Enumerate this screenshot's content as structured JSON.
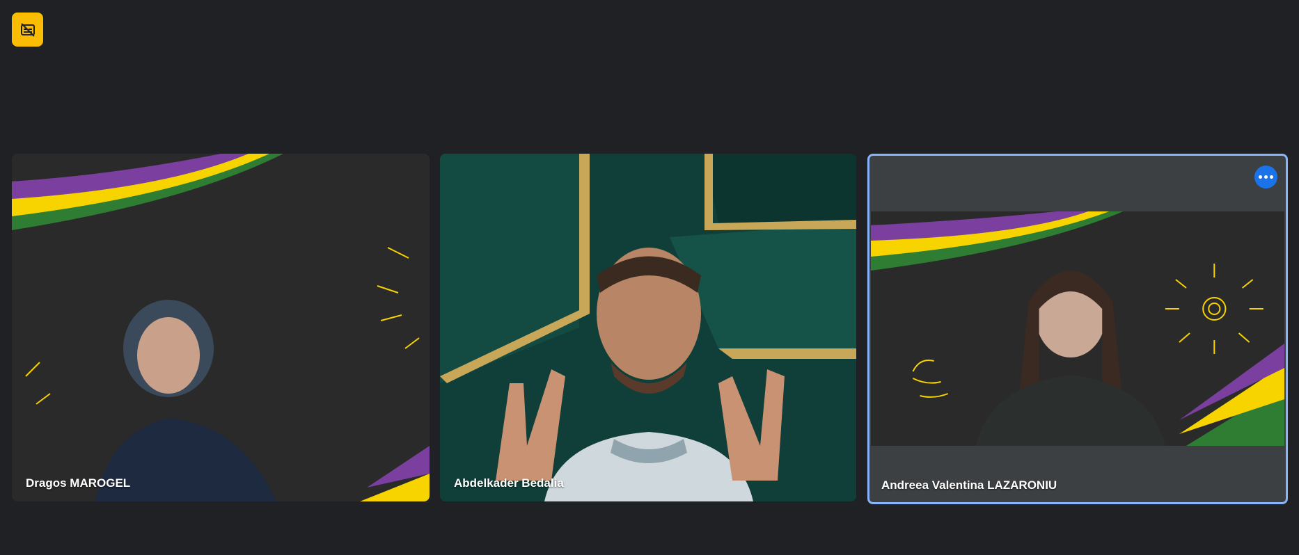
{
  "participants": [
    {
      "name": "Dragos MAROGEL"
    },
    {
      "name": "Abdelkader Bedalia"
    },
    {
      "name": "Andreea Valentina LAZARONIU",
      "active_speaker": true
    }
  ],
  "colors": {
    "background": "#202124",
    "badge": "#fbbc04",
    "active_border": "#8ab4f8",
    "more_button": "#1a73e8"
  },
  "icons": {
    "top_badge": "captions-off-icon",
    "tile_menu": "more-options-icon"
  }
}
